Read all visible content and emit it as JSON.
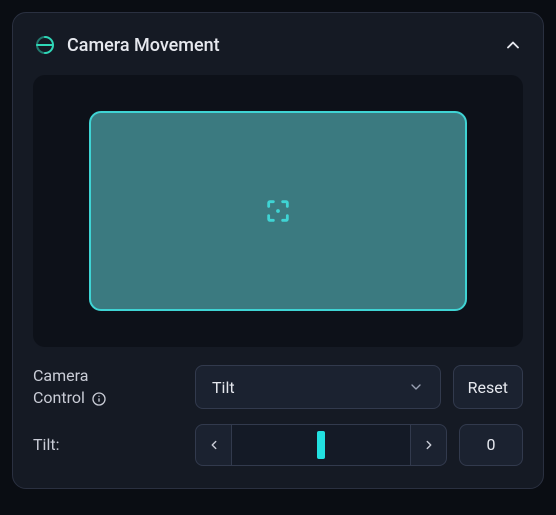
{
  "panel": {
    "title": "Camera Movement"
  },
  "controls": {
    "label_line1": "Camera",
    "label_line2": "Control",
    "select_value": "Tilt",
    "reset_label": "Reset"
  },
  "slider": {
    "label": "Tilt:",
    "value": "0"
  }
}
